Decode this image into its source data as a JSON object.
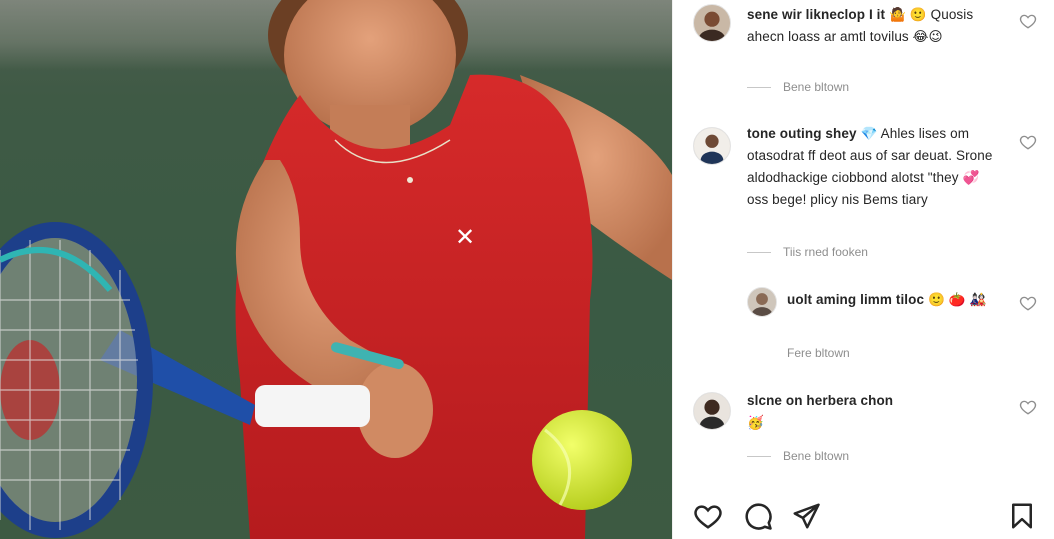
{
  "post": {
    "comments": [
      {
        "username": "sene wir likneclop I it",
        "text": "🤷 🙂 Quosis ahecn loass ar amtl tovilus 😂😉",
        "meta_label": "Bene bltown"
      },
      {
        "username": "tone outing shey",
        "text": "💎 Ahles lises om otasodrat ff deot aus of sar deuat. Srone aldodhackige ciobbond alotst \"they 💞 oss bege! plicy nis Bems tiary",
        "meta_label": "Tiis rned fooken"
      },
      {
        "username": "uolt aming limm tiloc",
        "text": "🙂 🍅 🎎",
        "meta_label": "Fere bltown"
      },
      {
        "username": "slcne on herbera chon",
        "text": "🥳",
        "meta_label": "Bene bltown"
      }
    ],
    "icons": {
      "like": "heart-icon",
      "comment": "comment-bubble-icon",
      "share": "send-icon",
      "save": "bookmark-icon"
    }
  }
}
